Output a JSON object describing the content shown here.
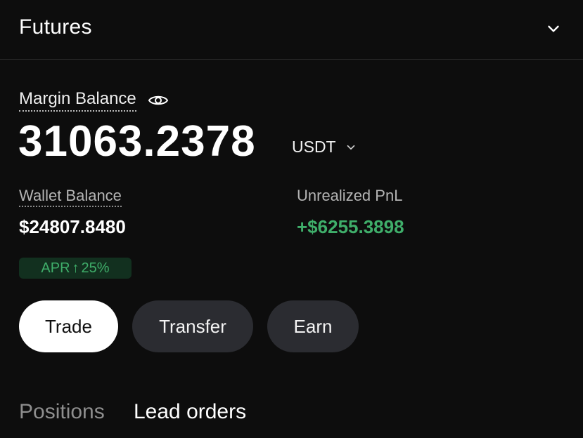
{
  "header": {
    "title": "Futures",
    "chevron_icon": "chevron-down-icon"
  },
  "margin": {
    "label": "Margin Balance",
    "eye_icon": "eye-icon",
    "value": "31063.2378",
    "currency": "USDT"
  },
  "wallet": {
    "label": "Wallet Balance",
    "value": "$24807.8480"
  },
  "pnl": {
    "label": "Unrealized PnL",
    "value": "+$6255.3898"
  },
  "apr": {
    "prefix": "APR",
    "arrow": "↑",
    "value": "25%"
  },
  "actions": {
    "trade": "Trade",
    "transfer": "Transfer",
    "earn": "Earn"
  },
  "tabs": [
    {
      "label": "Positions",
      "active": false
    },
    {
      "label": "Lead orders",
      "active": true
    }
  ],
  "colors": {
    "background": "#0d0d0d",
    "positive": "#3fae6a",
    "button_dark": "#2b2c31",
    "button_light": "#ffffff"
  }
}
